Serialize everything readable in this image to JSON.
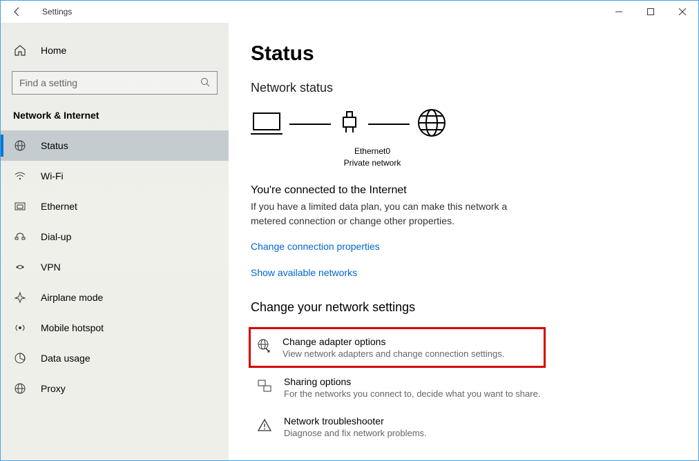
{
  "window": {
    "title": "Settings"
  },
  "sidebar": {
    "home": "Home",
    "search_placeholder": "Find a setting",
    "section": "Network & Internet",
    "items": [
      {
        "label": "Status"
      },
      {
        "label": "Wi-Fi"
      },
      {
        "label": "Ethernet"
      },
      {
        "label": "Dial-up"
      },
      {
        "label": "VPN"
      },
      {
        "label": "Airplane mode"
      },
      {
        "label": "Mobile hotspot"
      },
      {
        "label": "Data usage"
      },
      {
        "label": "Proxy"
      }
    ]
  },
  "main": {
    "title": "Status",
    "status_heading": "Network status",
    "ethernet_name": "Ethernet0",
    "network_type": "Private network",
    "connected_title": "You're connected to the Internet",
    "connected_desc": "If you have a limited data plan, you can make this network a metered connection or change other properties.",
    "link_change_props": "Change connection properties",
    "link_show_networks": "Show available networks",
    "change_heading": "Change your network settings",
    "tiles": [
      {
        "title": "Change adapter options",
        "desc": "View network adapters and change connection settings."
      },
      {
        "title": "Sharing options",
        "desc": "For the networks you connect to, decide what you want to share."
      },
      {
        "title": "Network troubleshooter",
        "desc": "Diagnose and fix network problems."
      }
    ]
  }
}
